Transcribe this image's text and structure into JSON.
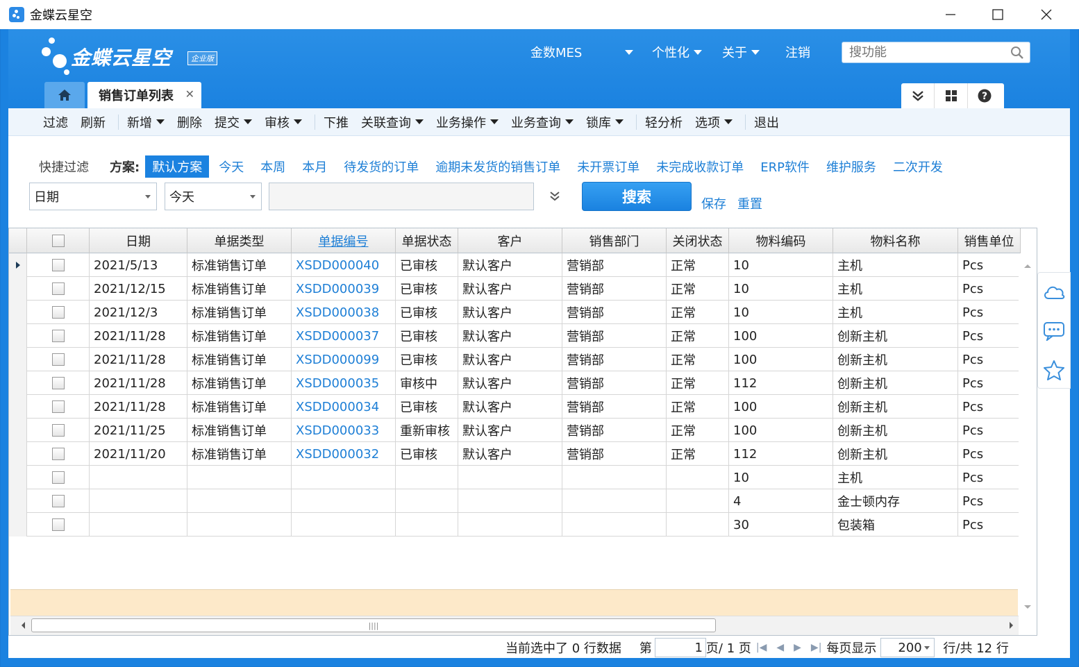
{
  "window": {
    "title": "金蝶云星空"
  },
  "logo": {
    "text": "金蝶云星空",
    "badge": "企业版"
  },
  "topnav": {
    "mes": "金数MES",
    "personalize": "个性化",
    "about": "关于",
    "logout": "注销"
  },
  "search": {
    "placeholder": "搜功能"
  },
  "tabs": {
    "active": "销售订单列表"
  },
  "toolbar": {
    "filter": "过滤",
    "refresh": "刷新",
    "new": "新增",
    "delete": "删除",
    "submit": "提交",
    "audit": "审核",
    "push": "下推",
    "linked_query": "关联查询",
    "biz_ops": "业务操作",
    "biz_query": "业务查询",
    "lock": "锁库",
    "light_analysis": "轻分析",
    "options": "选项",
    "exit": "退出"
  },
  "quick_filter": {
    "label": "快捷过滤",
    "scheme_label": "方案:",
    "tags": [
      "默认方案",
      "今天",
      "本周",
      "本月",
      "待发货的订单",
      "逾期未发货的销售订单",
      "未开票订单",
      "未完成收款订单",
      "ERP软件",
      "维护服务",
      "二次开发"
    ],
    "field": "日期",
    "operator": "今天",
    "value": "",
    "search_btn": "搜索",
    "save": "保存",
    "reset": "重置"
  },
  "grid": {
    "headers": [
      "日期",
      "单据类型",
      "单据编号",
      "单据状态",
      "客户",
      "销售部门",
      "关闭状态",
      "物料编码",
      "物料名称",
      "销售单位"
    ],
    "rows": [
      [
        "2021/5/13",
        "标准销售订单",
        "XSDD000040",
        "已审核",
        "默认客户",
        "营销部",
        "正常",
        "10",
        "主机",
        "Pcs"
      ],
      [
        "2021/12/15",
        "标准销售订单",
        "XSDD000039",
        "已审核",
        "默认客户",
        "营销部",
        "正常",
        "10",
        "主机",
        "Pcs"
      ],
      [
        "2021/12/3",
        "标准销售订单",
        "XSDD000038",
        "已审核",
        "默认客户",
        "营销部",
        "正常",
        "10",
        "主机",
        "Pcs"
      ],
      [
        "2021/11/28",
        "标准销售订单",
        "XSDD000037",
        "已审核",
        "默认客户",
        "营销部",
        "正常",
        "100",
        "创新主机",
        "Pcs"
      ],
      [
        "2021/11/28",
        "标准销售订单",
        "XSDD000099",
        "已审核",
        "默认客户",
        "营销部",
        "正常",
        "100",
        "创新主机",
        "Pcs"
      ],
      [
        "2021/11/28",
        "标准销售订单",
        "XSDD000035",
        "审核中",
        "默认客户",
        "营销部",
        "正常",
        "112",
        "创新主机",
        "Pcs"
      ],
      [
        "2021/11/28",
        "标准销售订单",
        "XSDD000034",
        "已审核",
        "默认客户",
        "营销部",
        "正常",
        "100",
        "创新主机",
        "Pcs"
      ],
      [
        "2021/11/25",
        "标准销售订单",
        "XSDD000033",
        "重新审核",
        "默认客户",
        "营销部",
        "正常",
        "100",
        "创新主机",
        "Pcs"
      ],
      [
        "2021/11/20",
        "标准销售订单",
        "XSDD000032",
        "已审核",
        "默认客户",
        "营销部",
        "正常",
        "112",
        "创新主机",
        "Pcs"
      ],
      [
        "",
        "",
        "",
        "",
        "",
        "",
        "",
        "10",
        "主机",
        "Pcs"
      ],
      [
        "",
        "",
        "",
        "",
        "",
        "",
        "",
        "4",
        "金士顿内存",
        "Pcs"
      ],
      [
        "",
        "",
        "",
        "",
        "",
        "",
        "",
        "30",
        "包装箱",
        "Pcs"
      ]
    ]
  },
  "pager": {
    "selected": "当前选中了 0 行数据",
    "page_prefix": "第",
    "page_no": "1",
    "page_suffix": "页/ 1 页",
    "per_page_label": "每页显示",
    "per_page": "200",
    "total": "行/共 12 行"
  }
}
